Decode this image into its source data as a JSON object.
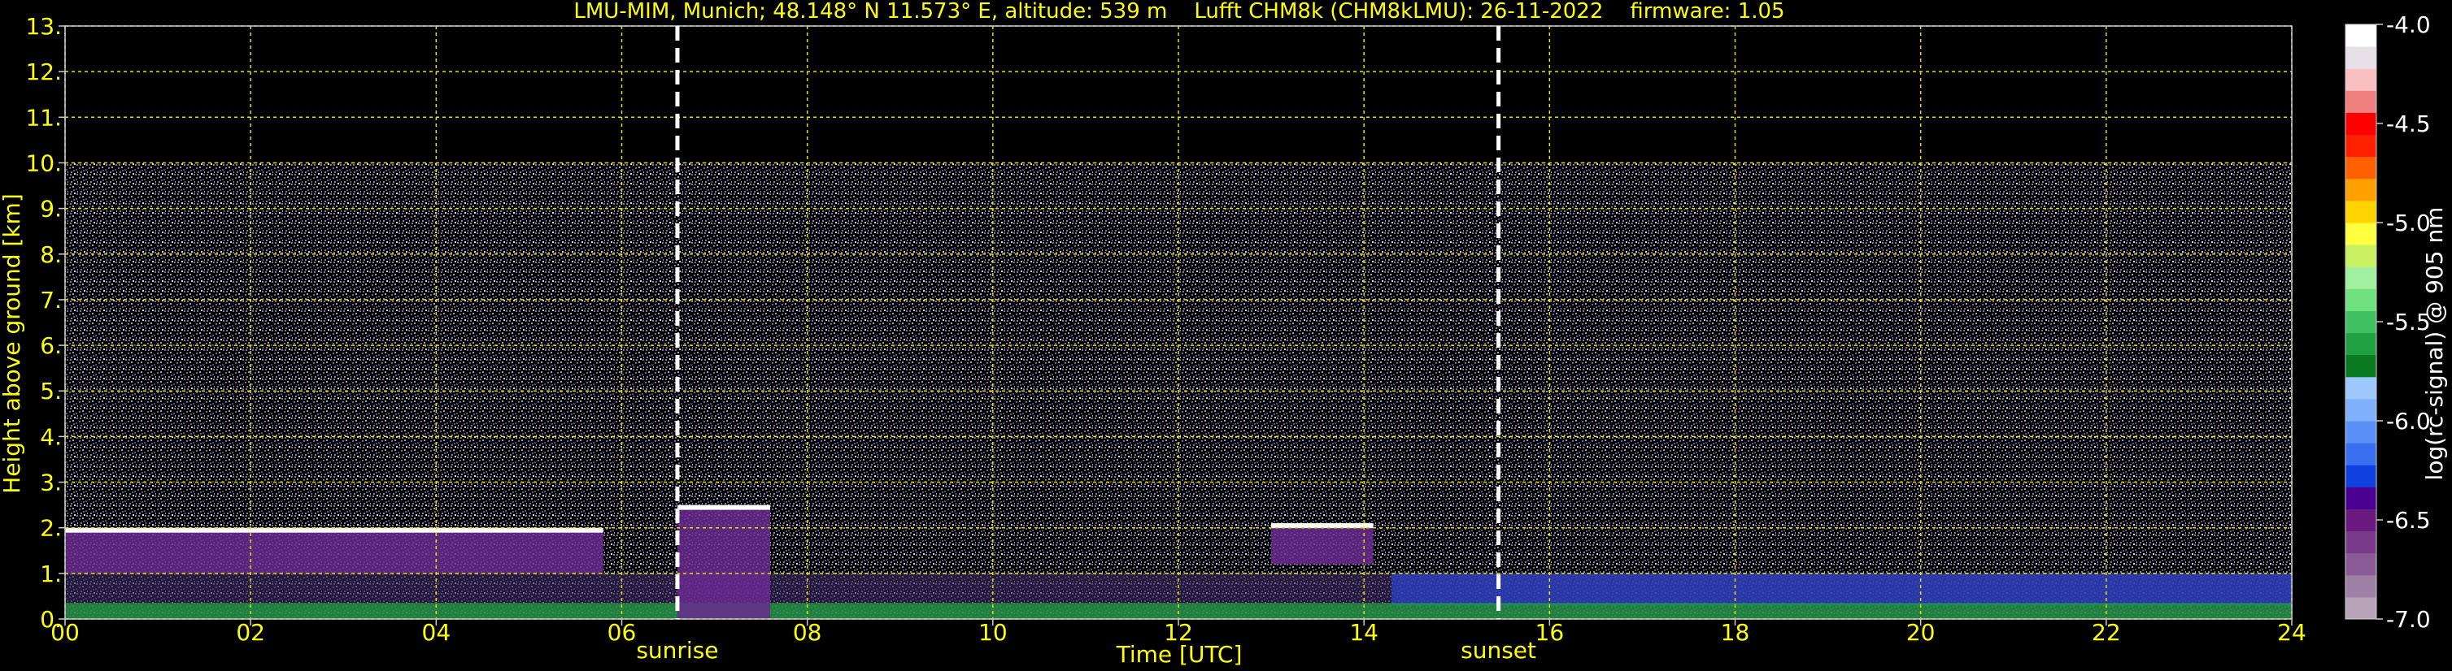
{
  "chart_data": {
    "type": "heatmap",
    "title": "LMU-MIM, Munich; 48.148° N 11.573° E, altitude: 539 m    Lufft CHM8k (CHM8kLMU): 26-11-2022    firmware: 1.05",
    "xlabel": "Time [UTC]",
    "ylabel": "Height above ground [km]",
    "xlim": [
      0,
      24
    ],
    "ylim": [
      0,
      13
    ],
    "x_ticks": [
      "00",
      "02",
      "04",
      "06",
      "08",
      "10",
      "12",
      "14",
      "16",
      "18",
      "20",
      "22",
      "24"
    ],
    "y_ticks": [
      "0.",
      "1.",
      "2.",
      "3.",
      "4.",
      "5.",
      "6.",
      "7.",
      "8.",
      "9.",
      "10.",
      "11.",
      "12.",
      "13."
    ],
    "grid": true,
    "sun_markers": [
      {
        "label": "sunrise",
        "time": 6.6
      },
      {
        "label": "sunset",
        "time": 15.45
      }
    ],
    "signal_top_km": 10.0,
    "noise_color": "#6a5a8c",
    "cloud_layers": [
      {
        "start": 0.0,
        "end": 5.8,
        "top": 2.0,
        "base": 1.0
      },
      {
        "start": 6.6,
        "end": 7.6,
        "top": 2.5,
        "base": 0.0
      },
      {
        "start": 13.0,
        "end": 14.1,
        "top": 2.1,
        "base": 1.2
      }
    ],
    "colorbar": {
      "label": "log(rc-signal) @ 905 nm",
      "min": -7.0,
      "max": -4.0,
      "ticks": [
        "-4.0",
        "-4.5",
        "-5.0",
        "-5.5",
        "-6.0",
        "-6.5",
        "-7.0"
      ],
      "colors": [
        "#b7a4b8",
        "#9e7fa6",
        "#8a5a96",
        "#7a3a8a",
        "#6a1a80",
        "#4a0090",
        "#1040e0",
        "#3a70f0",
        "#5a90f8",
        "#7fb0fc",
        "#9ec8fc",
        "#0a7a20",
        "#20a040",
        "#40c060",
        "#70e080",
        "#a0f0a0",
        "#c8f060",
        "#ffff40",
        "#ffd400",
        "#ffa000",
        "#ff6000",
        "#ff2000",
        "#ff0000",
        "#f08080",
        "#f8c0c0",
        "#e8e0e8",
        "#ffffff"
      ]
    }
  }
}
